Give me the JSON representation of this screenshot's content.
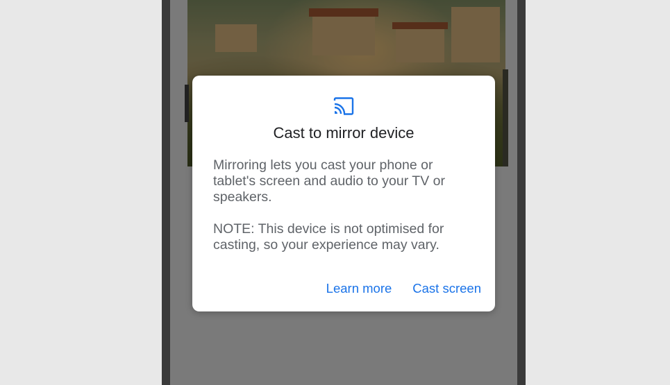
{
  "dialog": {
    "icon": "cast-icon",
    "title": "Cast to mirror device",
    "body": "Mirroring lets you cast your phone or tablet's screen and audio to your TV or speakers.",
    "note": "NOTE: This device is not optimised for casting, so your experience may vary.",
    "learn_more_label": "Learn more",
    "cast_screen_label": "Cast screen"
  },
  "colors": {
    "accent": "#1a73e8",
    "title": "#202124",
    "body": "#5f6368",
    "scrim": "#7a7a7a"
  }
}
